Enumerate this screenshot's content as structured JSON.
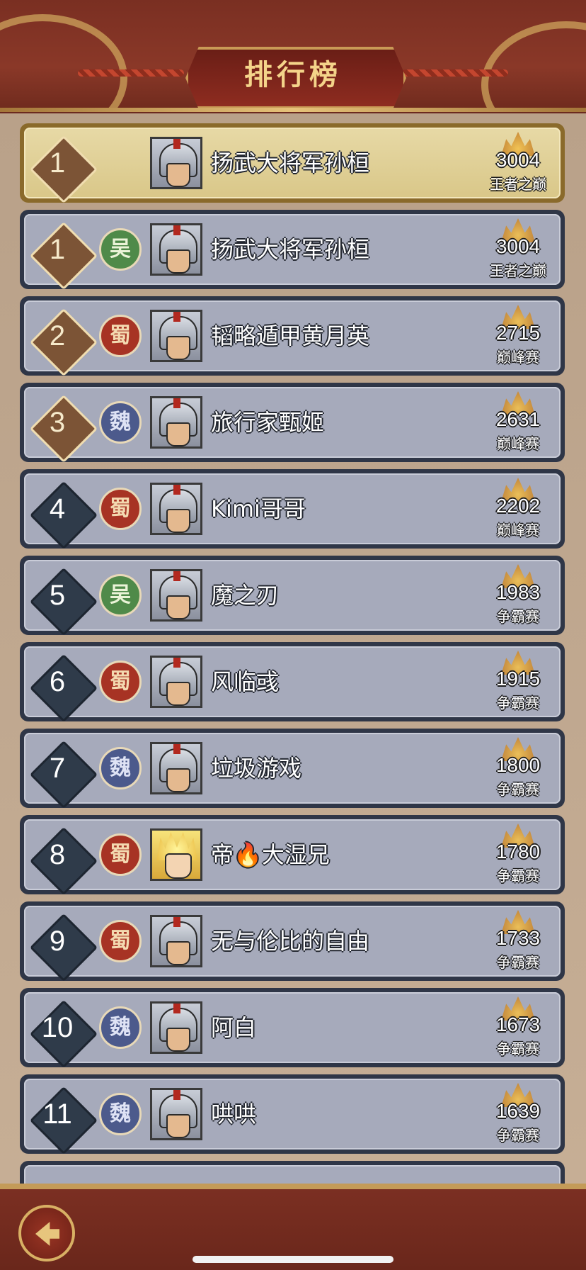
{
  "header": {
    "title": "排行榜"
  },
  "my_rank": {
    "rank": "1",
    "name": "扬武大将军孙桓",
    "score": "3004",
    "tier": "王者之巅"
  },
  "rows": [
    {
      "rank": "1",
      "faction": "吴",
      "faction_type": "wu",
      "avatar": "helmet-warrior",
      "name": "扬武大将军孙桓",
      "score": "3004",
      "tier": "王者之巅"
    },
    {
      "rank": "2",
      "faction": "蜀",
      "faction_type": "shu",
      "avatar": "helmet-warrior",
      "name": "韬略遁甲黄月英",
      "score": "2715",
      "tier": "巅峰赛"
    },
    {
      "rank": "3",
      "faction": "魏",
      "faction_type": "wei",
      "avatar": "helmet-warrior",
      "name": "旅行家甄姬",
      "score": "2631",
      "tier": "巅峰赛"
    },
    {
      "rank": "4",
      "faction": "蜀",
      "faction_type": "shu",
      "avatar": "helmet-warrior",
      "name": "Kimi哥哥",
      "score": "2202",
      "tier": "巅峰赛"
    },
    {
      "rank": "5",
      "faction": "吴",
      "faction_type": "wu",
      "avatar": "helmet-warrior",
      "name": "魔之刃",
      "score": "1983",
      "tier": "争霸赛"
    },
    {
      "rank": "6",
      "faction": "蜀",
      "faction_type": "shu",
      "avatar": "helmet-warrior",
      "name": "风临彧",
      "score": "1915",
      "tier": "争霸赛"
    },
    {
      "rank": "7",
      "faction": "魏",
      "faction_type": "wei",
      "avatar": "helmet-warrior",
      "name": "垃圾游戏",
      "score": "1800",
      "tier": "争霸赛"
    },
    {
      "rank": "8",
      "faction": "蜀",
      "faction_type": "shu",
      "avatar": "blonde-anime",
      "name": "帝🔥大湿兄",
      "score": "1780",
      "tier": "争霸赛"
    },
    {
      "rank": "9",
      "faction": "蜀",
      "faction_type": "shu",
      "avatar": "helmet-warrior",
      "name": "无与伦比的自由",
      "score": "1733",
      "tier": "争霸赛"
    },
    {
      "rank": "10",
      "faction": "魏",
      "faction_type": "wei",
      "avatar": "helmet-warrior",
      "name": "阿白",
      "score": "1673",
      "tier": "争霸赛"
    },
    {
      "rank": "11",
      "faction": "魏",
      "faction_type": "wei",
      "avatar": "helmet-warrior",
      "name": "哄哄",
      "score": "1639",
      "tier": "争霸赛"
    }
  ],
  "footer": {
    "back_icon": "back-arrow-icon"
  },
  "colors": {
    "row_bg": "#a6aabb",
    "row_border": "#2f3647",
    "mine_bg": "#e7d9a6",
    "header_bg": "#7a2f22",
    "accent_gold": "#c99a56"
  }
}
